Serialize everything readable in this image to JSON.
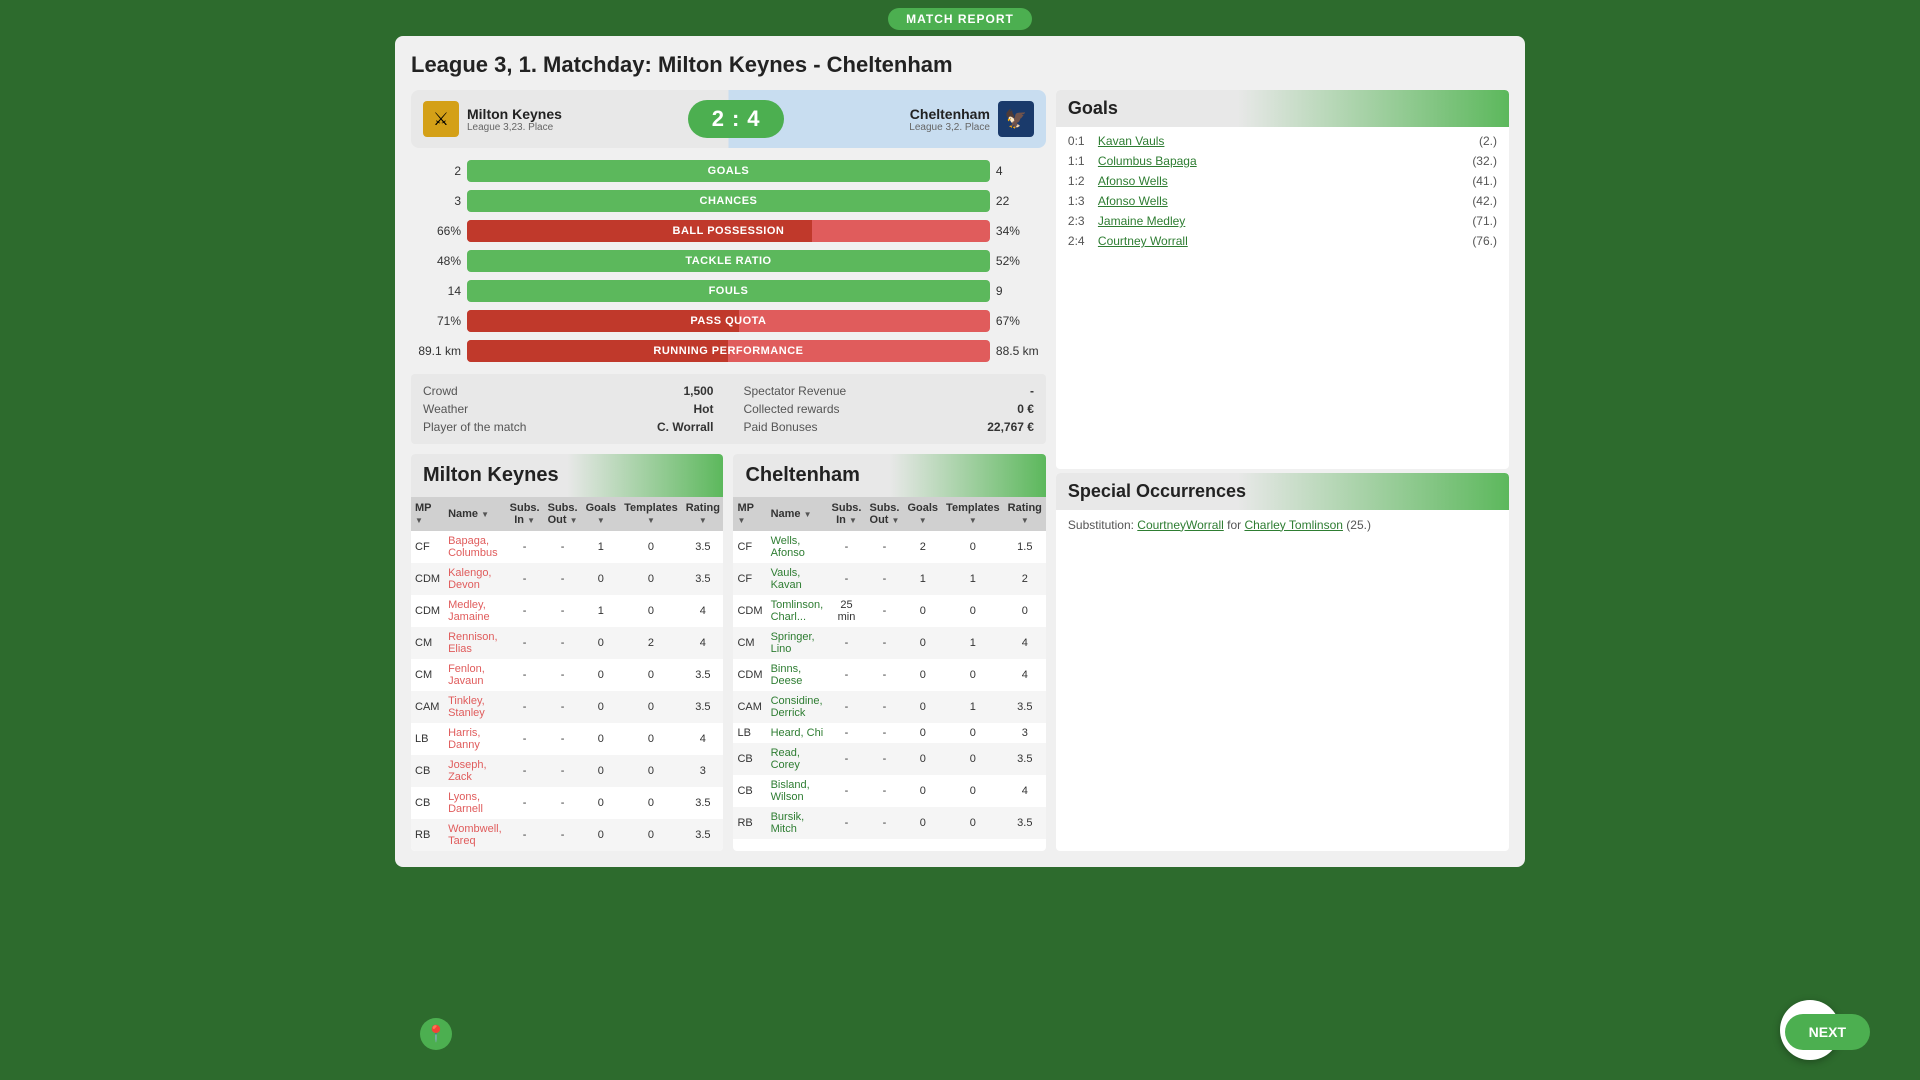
{
  "header": {
    "match_report_label": "MATCH REPORT",
    "title": "League 3, 1. Matchday: Milton Keynes - Cheltenham"
  },
  "score": {
    "home_team": "Milton Keynes",
    "home_league": "League 3,23. Place",
    "away_team": "Cheltenham",
    "away_league": "League 3,2. Place",
    "home_score": "2",
    "separator": ":",
    "away_score": "4"
  },
  "stats": [
    {
      "left": "2",
      "label": "GOALS",
      "right": "4",
      "home_pct": 33,
      "type": "green"
    },
    {
      "left": "3",
      "label": "CHANCES",
      "right": "22",
      "home_pct": 12,
      "type": "green"
    },
    {
      "left": "66%",
      "label": "BALL POSSESSION",
      "right": "34%",
      "home_pct": 66,
      "type": "red"
    },
    {
      "left": "48%",
      "label": "TACKLE RATIO",
      "right": "52%",
      "home_pct": 48,
      "type": "green"
    },
    {
      "left": "14",
      "label": "FOULS",
      "right": "9",
      "home_pct": 60,
      "type": "green"
    },
    {
      "left": "71%",
      "label": "PASS QUOTA",
      "right": "67%",
      "home_pct": 52,
      "type": "red"
    },
    {
      "left": "89.1 km",
      "label": "RUNNING PERFORMANCE",
      "right": "88.5 km",
      "home_pct": 50,
      "type": "red"
    }
  ],
  "extra_stats": {
    "left": [
      {
        "label": "Crowd",
        "value": "1,500"
      },
      {
        "label": "Weather",
        "value": "Hot"
      },
      {
        "label": "Player of the match",
        "value": "C. Worrall"
      }
    ],
    "right": [
      {
        "label": "Spectator Revenue",
        "value": "-"
      },
      {
        "label": "Collected rewards",
        "value": "0 €"
      },
      {
        "label": "Paid Bonuses",
        "value": "22,767 €"
      }
    ]
  },
  "goals_panel": {
    "title": "Goals",
    "goals": [
      {
        "score": "0:1",
        "scorer": "Kavan Vauls",
        "time": "(2.)"
      },
      {
        "score": "1:1",
        "scorer": "Columbus Bapaga",
        "time": "(32.)"
      },
      {
        "score": "1:2",
        "scorer": "Afonso Wells",
        "time": "(41.)"
      },
      {
        "score": "1:3",
        "scorer": "Afonso Wells",
        "time": "(42.)"
      },
      {
        "score": "2:3",
        "scorer": "Jamaine Medley",
        "time": "(71.)"
      },
      {
        "score": "2:4",
        "scorer": "Courtney Worrall",
        "time": "(76.)"
      }
    ]
  },
  "special_panel": {
    "title": "Special Occurrences",
    "items": [
      {
        "text": "Substitution: ",
        "player_out": "CourtneyWorrall",
        "connector": " for ",
        "player_in": "Charley Tomlinson",
        "time": "(25.)"
      }
    ]
  },
  "home_team_table": {
    "title": "Milton Keynes",
    "columns": [
      "MP",
      "Name",
      "Subs. In",
      "Subs. Out",
      "Goals",
      "Templates",
      "Rating"
    ],
    "rows": [
      {
        "pos": "CF",
        "name": "Bapaga, Columbus",
        "subs_in": "-",
        "subs_out": "-",
        "goals": "1",
        "templates": "0",
        "rating": "3.5",
        "highlight": true
      },
      {
        "pos": "CDM",
        "name": "Kalengo, Devon",
        "subs_in": "-",
        "subs_out": "-",
        "goals": "0",
        "templates": "0",
        "rating": "3.5",
        "highlight": true
      },
      {
        "pos": "CDM",
        "name": "Medley, Jamaine",
        "subs_in": "-",
        "subs_out": "-",
        "goals": "1",
        "templates": "0",
        "rating": "4",
        "highlight": true
      },
      {
        "pos": "CM",
        "name": "Rennison, Elias",
        "subs_in": "-",
        "subs_out": "-",
        "goals": "0",
        "templates": "2",
        "rating": "4",
        "highlight": true
      },
      {
        "pos": "CM",
        "name": "Fenlon, Javaun",
        "subs_in": "-",
        "subs_out": "-",
        "goals": "0",
        "templates": "0",
        "rating": "3.5",
        "highlight": true
      },
      {
        "pos": "CAM",
        "name": "Tinkley, Stanley",
        "subs_in": "-",
        "subs_out": "-",
        "goals": "0",
        "templates": "0",
        "rating": "3.5",
        "highlight": true
      },
      {
        "pos": "LB",
        "name": "Harris, Danny",
        "subs_in": "-",
        "subs_out": "-",
        "goals": "0",
        "templates": "0",
        "rating": "4",
        "highlight": true
      },
      {
        "pos": "CB",
        "name": "Joseph, Zack",
        "subs_in": "-",
        "subs_out": "-",
        "goals": "0",
        "templates": "0",
        "rating": "3",
        "highlight": true
      },
      {
        "pos": "CB",
        "name": "Lyons, Darnell",
        "subs_in": "-",
        "subs_out": "-",
        "goals": "0",
        "templates": "0",
        "rating": "3.5",
        "highlight": true
      },
      {
        "pos": "RB",
        "name": "Wombwell, Tareq",
        "subs_in": "-",
        "subs_out": "-",
        "goals": "0",
        "templates": "0",
        "rating": "3.5",
        "highlight": true
      }
    ]
  },
  "away_team_table": {
    "title": "Cheltenham",
    "columns": [
      "MP",
      "Name",
      "Subs. In",
      "Subs. Out",
      "Goals",
      "Templates",
      "Rating"
    ],
    "rows": [
      {
        "pos": "CF",
        "name": "Wells, Afonso",
        "subs_in": "-",
        "subs_out": "-",
        "goals": "2",
        "templates": "0",
        "rating": "1.5"
      },
      {
        "pos": "CF",
        "name": "Vauls, Kavan",
        "subs_in": "-",
        "subs_out": "-",
        "goals": "1",
        "templates": "1",
        "rating": "2"
      },
      {
        "pos": "CDM",
        "name": "Tomlinson, Charl...",
        "subs_in": "25 min",
        "subs_out": "-",
        "goals": "0",
        "templates": "0",
        "rating": "0"
      },
      {
        "pos": "CM",
        "name": "Springer, Lino",
        "subs_in": "-",
        "subs_out": "-",
        "goals": "0",
        "templates": "1",
        "rating": "4"
      },
      {
        "pos": "CDM",
        "name": "Binns, Deese",
        "subs_in": "-",
        "subs_out": "-",
        "goals": "0",
        "templates": "0",
        "rating": "4"
      },
      {
        "pos": "CAM",
        "name": "Considine, Derrick",
        "subs_in": "-",
        "subs_out": "-",
        "goals": "0",
        "templates": "1",
        "rating": "3.5"
      },
      {
        "pos": "LB",
        "name": "Heard, Chi",
        "subs_in": "-",
        "subs_out": "-",
        "goals": "0",
        "templates": "0",
        "rating": "3"
      },
      {
        "pos": "CB",
        "name": "Read, Corey",
        "subs_in": "-",
        "subs_out": "-",
        "goals": "0",
        "templates": "0",
        "rating": "3.5"
      },
      {
        "pos": "CB",
        "name": "Bisland, Wilson",
        "subs_in": "-",
        "subs_out": "-",
        "goals": "0",
        "templates": "0",
        "rating": "4"
      },
      {
        "pos": "RB",
        "name": "Bursik, Mitch",
        "subs_in": "-",
        "subs_out": "-",
        "goals": "0",
        "templates": "0",
        "rating": "3.5"
      }
    ]
  },
  "next_button_label": "NEXT",
  "location_icon": "📍"
}
